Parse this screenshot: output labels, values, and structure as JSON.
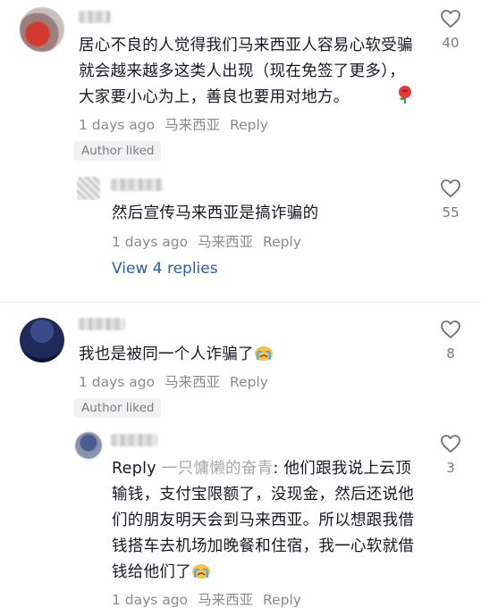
{
  "comments": [
    {
      "text": "居心不良的人觉得我们马来西亚人容易心软受骗就会越来越多这类人出现（现在免签了更多），大家要小心为上，善良也要用对地方。",
      "time": "1 days ago",
      "location": "马来西亚",
      "reply_label": "Reply",
      "badge": "Author liked",
      "likes": "40",
      "emoji_icon": "rose-emoji",
      "replies": [
        {
          "text": "然后宣传马来西亚是搞诈骗的",
          "time": "1 days ago",
          "location": "马来西亚",
          "reply_label": "Reply",
          "likes": "55"
        }
      ],
      "view_replies": "View 4 replies"
    },
    {
      "text": "我也是被同一个人诈骗了",
      "time": "1 days ago",
      "location": "马来西亚",
      "reply_label": "Reply",
      "badge": "Author liked",
      "likes": "8",
      "emoji_icon": "crying-emoji",
      "replies": [
        {
          "reply_prefix": "Reply",
          "reply_to": "一只慵懒的奋青",
          "text": ": 他们跟我说上云顶输钱，支付宝限额了，没现金，然后还说他们的朋友明天会到马来西亚。所以想跟我借钱搭车去机场加晚餐和住宿，我一心软就借钱给他们了",
          "time": "1 days ago",
          "location": "马来西亚",
          "reply_label": "Reply",
          "likes": "3",
          "emoji_icon": "crying-emoji"
        }
      ]
    }
  ],
  "colors": {
    "link": "#2b5db3",
    "meta": "#8a8b91",
    "badge_bg": "#f1f1f2"
  }
}
